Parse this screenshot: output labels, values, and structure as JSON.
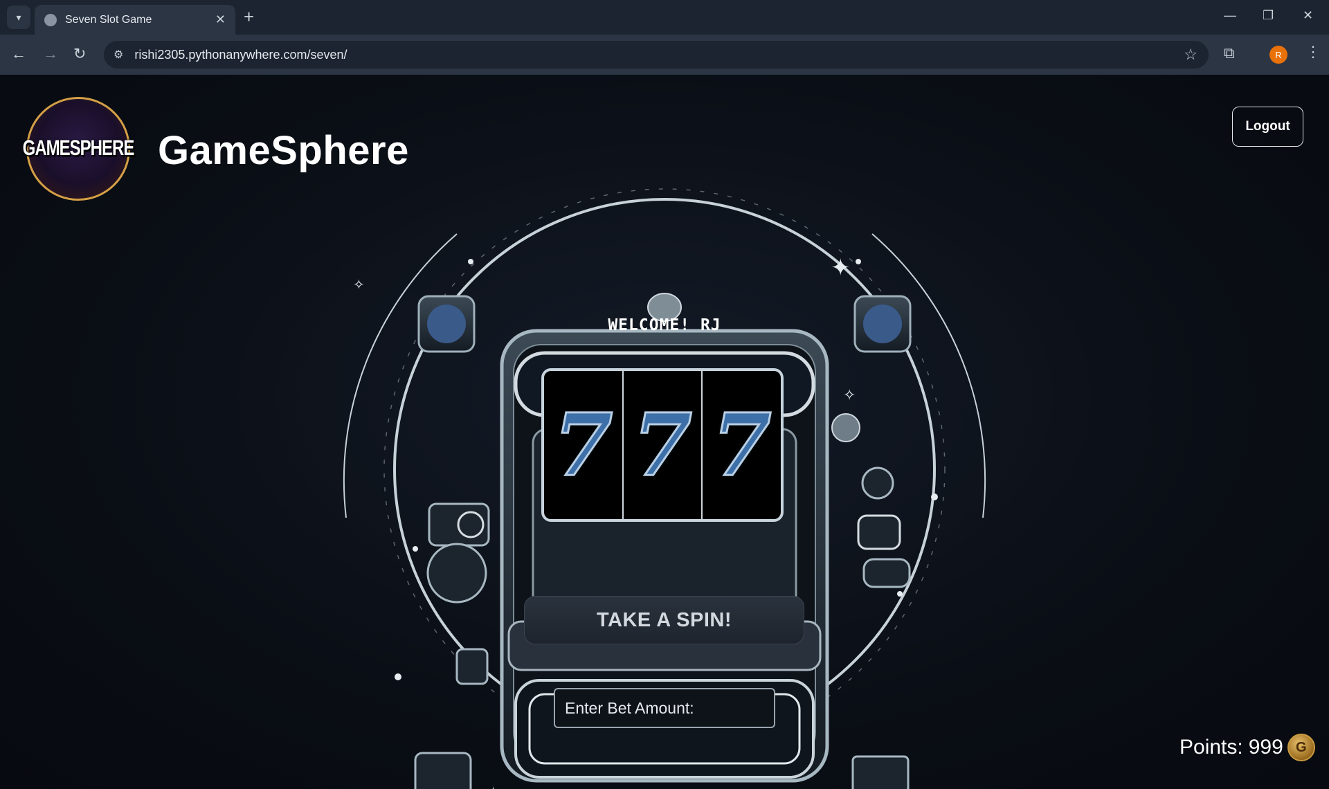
{
  "browser": {
    "tab_title": "Seven Slot Game",
    "url": "rishi2305.pythonanywhere.com/seven/",
    "avatar_letter": "R"
  },
  "header": {
    "logo_text": "GAMESPHERE",
    "brand": "GameSphere",
    "logout_label": "Logout"
  },
  "game": {
    "welcome": "WELCOME! RJ",
    "reels": [
      "7",
      "7",
      "7"
    ],
    "spin_label": "TAKE A SPIN!",
    "bet_placeholder": "Enter Bet Amount:"
  },
  "points": {
    "label": "Points:",
    "value": "999",
    "coin_letter": "G"
  },
  "colors": {
    "accent": "#3d6fa8",
    "background": "#0b0f16",
    "avatar": "#e8710a"
  }
}
